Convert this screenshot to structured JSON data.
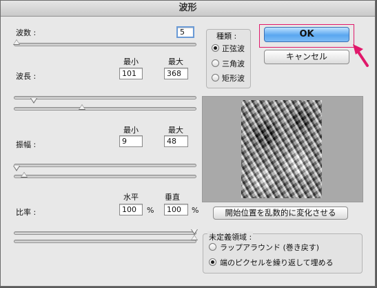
{
  "window": {
    "title": "波形"
  },
  "generators": {
    "label": "波数 :",
    "value": "5"
  },
  "wavelength": {
    "label": "波長 :",
    "min_label": "最小",
    "max_label": "最大",
    "min_value": "101",
    "max_value": "368"
  },
  "amplitude": {
    "label": "振幅 :",
    "min_label": "最小",
    "max_label": "最大",
    "min_value": "9",
    "max_value": "48"
  },
  "scale": {
    "label": "比率 :",
    "horiz_label": "水平",
    "vert_label": "垂直",
    "horiz_value": "100",
    "vert_value": "100",
    "unit": "%"
  },
  "type": {
    "title": "種類 :",
    "options": [
      "正弦波",
      "三角波",
      "矩形波"
    ],
    "selected": "正弦波"
  },
  "buttons": {
    "ok": "OK",
    "cancel": "キャンセル",
    "randomize": "開始位置を乱数的に変化させる"
  },
  "undefined_areas": {
    "title": "未定義領域 :",
    "options": [
      "ラップアラウンド (巻き戻す)",
      "端のピクセルを繰り返して埋める"
    ],
    "selected": "端のピクセルを繰り返して埋める"
  },
  "colors": {
    "highlight": "#e0186a",
    "ok_button": "#5aa7f0"
  },
  "icons": {
    "annotation": "arrow-icon"
  }
}
